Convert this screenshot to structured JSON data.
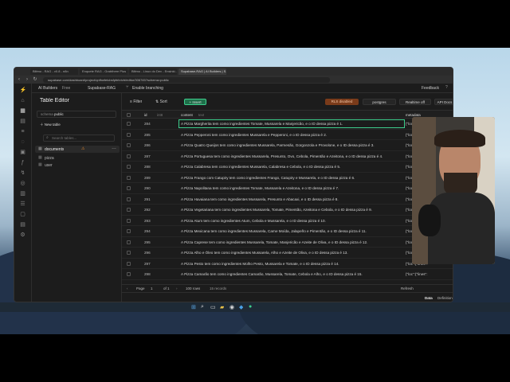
{
  "browser": {
    "tabs": [
      "Blitmo - RAG - v0.8 - n8n",
      "Enquete RAG - Grabthree Plus",
      "Blitmo - Linux do Dev - Ensinki...",
      "Supabase-RAG | AI Builders | S..."
    ],
    "url": "supabase.com/dashboard/project/qnfhwfetcbsfpfnhrivtr/editor/306745?schema=public"
  },
  "topnav": {
    "org": "AI Builders",
    "plan": "Free",
    "project": "Supabase-RAG",
    "branching": "Enable branching",
    "feedback": "Feedback"
  },
  "sidebar": {
    "title": "Table Editor",
    "schema_label": "schema",
    "schema_value": "public",
    "new_table": "New table",
    "search_placeholder": "Search tables...",
    "tables": [
      "documents",
      "pizza",
      "user"
    ]
  },
  "toolbar": {
    "filter": "Filter",
    "sort": "Sort",
    "insert": "Insert",
    "rls": "RLS disabled",
    "role": "postgres",
    "realtime": "Realtime off",
    "api_docs": "API Docs"
  },
  "columns": {
    "id": "id",
    "id_type": "int8",
    "content": "content",
    "content_type": "text",
    "metadata": "metadata"
  },
  "rows": [
    {
      "id": "284",
      "content": "A Pizza Margherita tem como ingredientes Tomate, Mussarela e Manjericão, e o ID dessa pizza é 1.",
      "metadata": "{\"loc\":{\"lines\":"
    },
    {
      "id": "285",
      "content": "A Pizza Pepperoni tem como ingredientes Mussarela e Pepperoni, e o ID dessa pizza é 2.",
      "metadata": "{\"loc\":{\"lines\":"
    },
    {
      "id": "286",
      "content": "A Pizza Quatro Queijos tem como ingredientes Mussarela, Parmesão, Gorgonzola e Provolone, e o ID dessa pizza é 3.",
      "metadata": "{\"loc\":{\"lines\":"
    },
    {
      "id": "287",
      "content": "A Pizza Portuguesa tem como ingredientes Mussarela, Presunto, Ovo, Cebola, Pimentão e Azeitona, e o ID dessa pizza é 4.",
      "metadata": "{\"loc\":{\"lines\":"
    },
    {
      "id": "288",
      "content": "A Pizza Calabresa tem como ingredientes Mussarela, Calabresa e Cebola, e o ID dessa pizza é 5.",
      "metadata": "{\"loc\":{\"lines\":"
    },
    {
      "id": "289",
      "content": "A Pizza Frango com Catupiry tem como ingredientes Frango, Catupiry e Mussarela, e o ID dessa pizza é 6.",
      "metadata": "{\"loc\":{\"lines\":"
    },
    {
      "id": "290",
      "content": "A Pizza Napolitana tem como ingredientes Tomate, Mussarela e Azeitona, e o ID dessa pizza é 7.",
      "metadata": "{\"loc\":{\"lines\":"
    },
    {
      "id": "291",
      "content": "A Pizza Havaiana tem como ingredientes Mussarela, Presunto e Abacaxi, e o ID dessa pizza é 8.",
      "metadata": "{\"loc\":{\"lines\":"
    },
    {
      "id": "292",
      "content": "A Pizza Vegetariana tem como ingredientes Mussarela, Tomate, Pimentão, Azeitona e Cebola, e o ID dessa pizza é 9.",
      "metadata": "{\"loc\":{\"lines\":"
    },
    {
      "id": "293",
      "content": "A Pizza Atum tem como ingredientes Atum, Cebola e Mussarela, e o ID dessa pizza é 10.",
      "metadata": "{\"loc\":{\"lines\":"
    },
    {
      "id": "294",
      "content": "A Pizza Mexicana tem como ingredientes Mussarela, Carne Moída, Jalapeño e Pimentão, e o ID dessa pizza é 11.",
      "metadata": "{\"loc\":{\"lines\":"
    },
    {
      "id": "295",
      "content": "A Pizza Caprese tem como ingredientes Mussarela, Tomate, Manjericão e Azeite de Oliva, e o ID dessa pizza é 12.",
      "metadata": "{\"loc\":{\"lines\":"
    },
    {
      "id": "296",
      "content": "A Pizza Alho e Óleo tem como ingredientes Mussarela, Alho e Azeite de Oliva, e o ID dessa pizza é 13.",
      "metadata": "{\"loc\":{\"lines\":"
    },
    {
      "id": "297",
      "content": "A Pizza Pesto tem como ingredientes Molho Pesto, Mussarela e Tomate, e o ID dessa pizza é 14.",
      "metadata": "{\"loc\":{\"lines\":"
    },
    {
      "id": "298",
      "content": "A Pizza Camarão tem como ingredientes Camarão, Mussarela, Tomate, Cebola e Alho, e o ID dessa pizza é 15.",
      "metadata": "{\"loc\":{\"lines\":"
    }
  ],
  "footer": {
    "page_label": "Page",
    "page": "1",
    "of": "of 1",
    "rows_per_page": "100 rows",
    "records": "15 records",
    "refresh": "Refresh",
    "data_tab": "Data",
    "definition_tab": "Definition"
  },
  "colors": {
    "accent": "#3ecf8e",
    "rls_badge": "#7a3b1a",
    "background": "#1c1c1c"
  }
}
